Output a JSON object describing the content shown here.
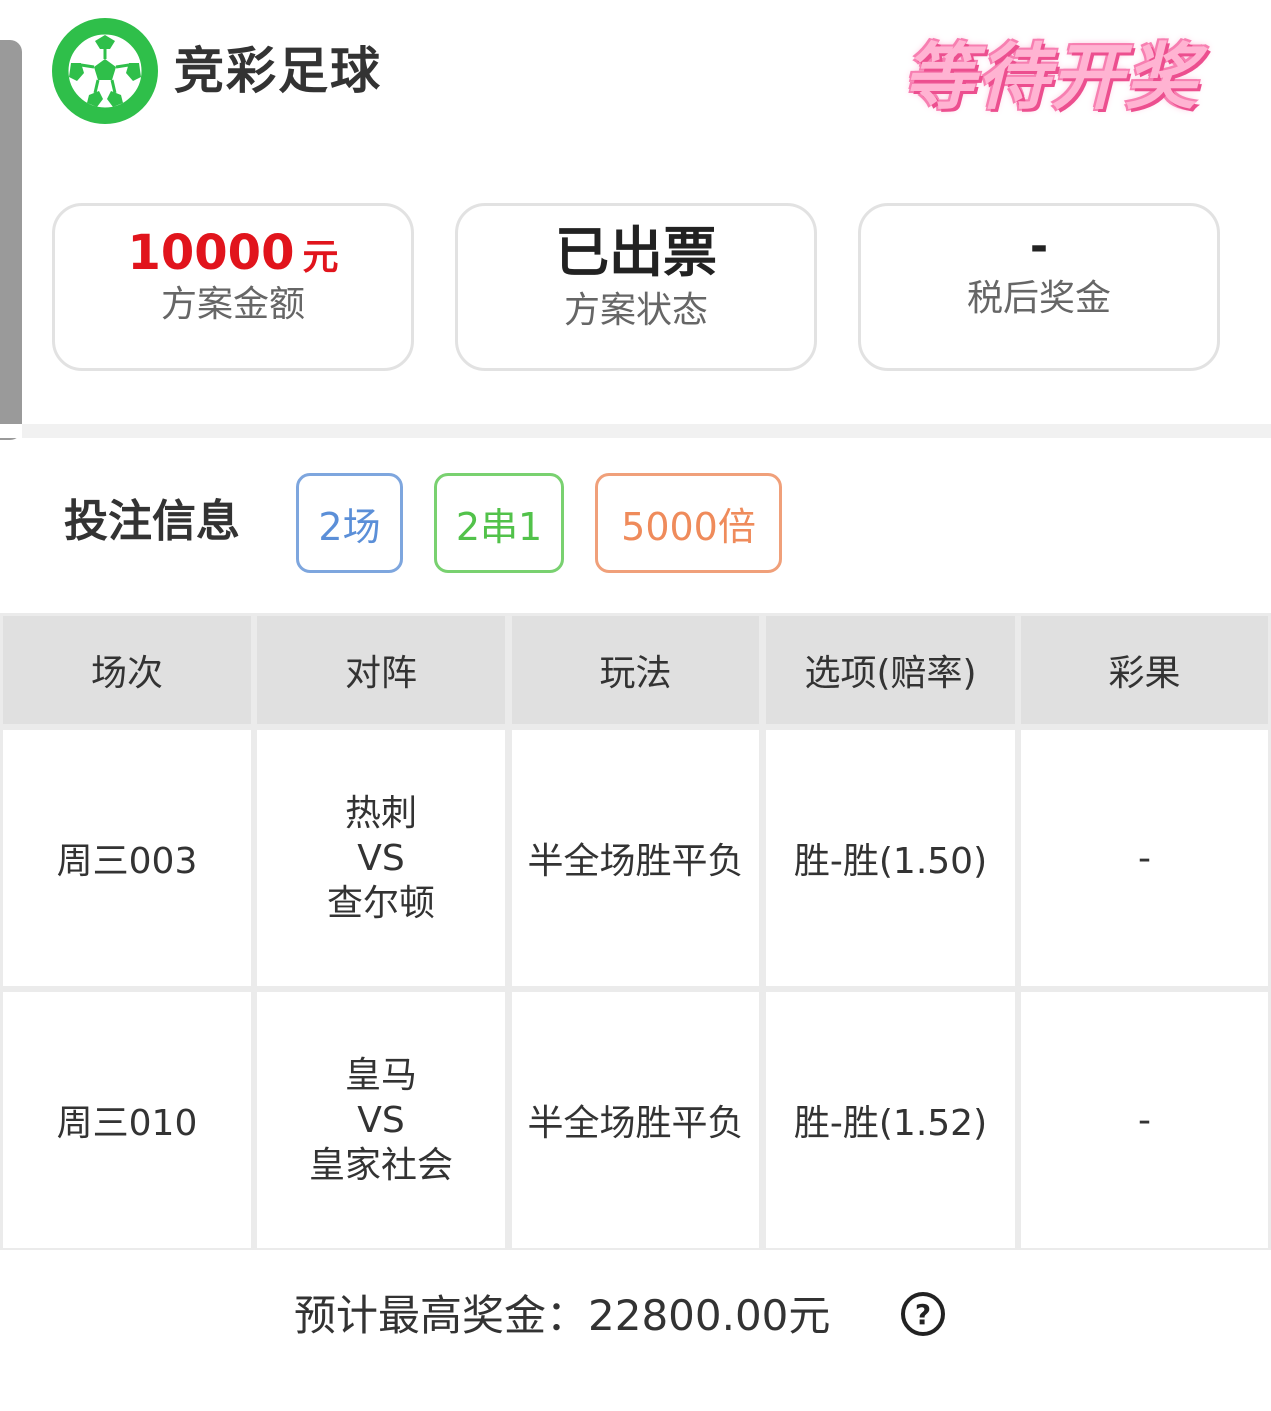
{
  "header": {
    "logo_icon": "soccer-ball-icon",
    "title": "竞彩足球",
    "stamp_text": "等待开奖",
    "stamp_color": "#ec4f8f"
  },
  "cards": {
    "amount": {
      "value": "10000",
      "unit": "元",
      "label": "方案金额",
      "color": "#e1141c"
    },
    "status": {
      "value": "已出票",
      "label": "方案状态"
    },
    "prize": {
      "value": "-",
      "label": "税后奖金"
    }
  },
  "bet_info": {
    "title": "投注信息",
    "tags": [
      {
        "text": "2场",
        "color": "#5b8fd8"
      },
      {
        "text": "2串1",
        "color": "#52c24a"
      },
      {
        "text": "5000倍",
        "color": "#ef8b5b"
      }
    ]
  },
  "table": {
    "headers": [
      "场次",
      "对阵",
      "玩法",
      "选项(赔率)",
      "彩果"
    ],
    "rows": [
      {
        "match_no": "周三003",
        "home": "热刺",
        "vs": "VS",
        "away": "查尔顿",
        "play": "半全场胜平负",
        "option": "胜-胜(1.50)",
        "result": "-"
      },
      {
        "match_no": "周三010",
        "home": "皇马",
        "vs": "VS",
        "away": "皇家社会",
        "play": "半全场胜平负",
        "option": "胜-胜(1.52)",
        "result": "-"
      }
    ]
  },
  "footer": {
    "estimate": "预计最高奖金：22800.00元",
    "help_icon": "question-circle-icon",
    "help_symbol": "?"
  }
}
